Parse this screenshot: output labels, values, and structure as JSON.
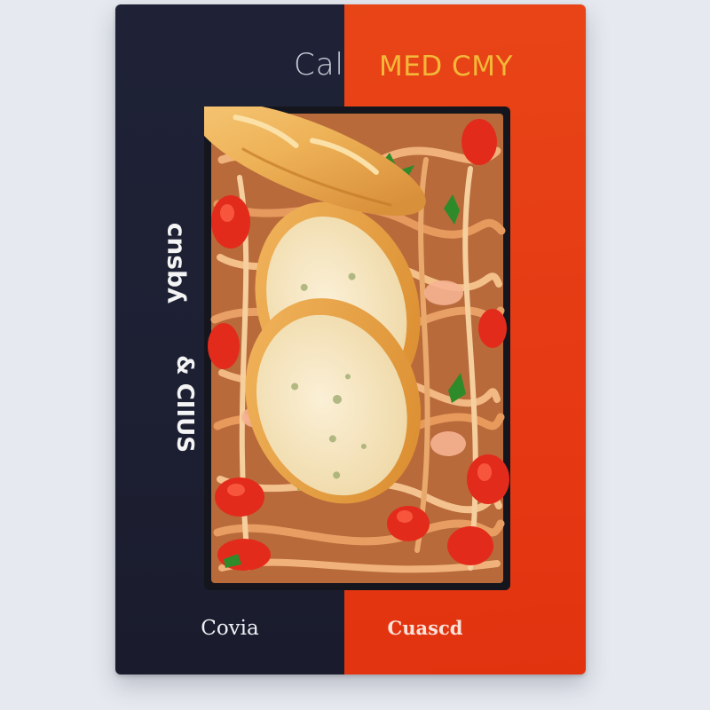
{
  "card": {
    "title_left": "Cal",
    "title_right": "MED CMY",
    "side_text_top": "cnsbʎ",
    "side_text_bottom": "& CIIUS",
    "bottom_left": "Covia",
    "bottom_right": "Cuascd"
  },
  "colors": {
    "background": "#e6e9ef",
    "navy_panel": "#1f2236",
    "red_panel": "#e63a14",
    "title_gold": "#f3b838"
  }
}
